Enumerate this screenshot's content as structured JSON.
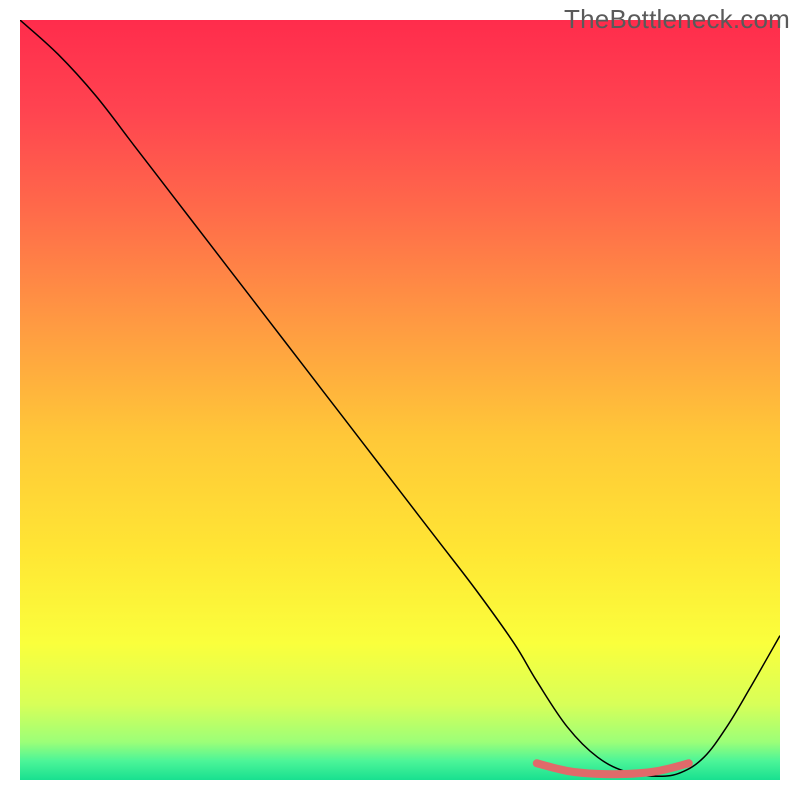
{
  "watermark": "TheBottleneck.com",
  "chart_data": {
    "type": "line",
    "title": "",
    "xlabel": "",
    "ylabel": "",
    "xlim": [
      0,
      100
    ],
    "ylim": [
      0,
      100
    ],
    "grid": false,
    "legend": false,
    "background_gradient": {
      "stops": [
        {
          "offset": 0.0,
          "color": "#ff2c4c"
        },
        {
          "offset": 0.12,
          "color": "#ff4450"
        },
        {
          "offset": 0.25,
          "color": "#ff6a4a"
        },
        {
          "offset": 0.4,
          "color": "#ff9a42"
        },
        {
          "offset": 0.55,
          "color": "#ffc838"
        },
        {
          "offset": 0.7,
          "color": "#ffe634"
        },
        {
          "offset": 0.82,
          "color": "#faff3c"
        },
        {
          "offset": 0.9,
          "color": "#d8ff58"
        },
        {
          "offset": 0.95,
          "color": "#9cff78"
        },
        {
          "offset": 0.975,
          "color": "#4cf598"
        },
        {
          "offset": 1.0,
          "color": "#18e090"
        }
      ]
    },
    "series": [
      {
        "name": "bottleneck-curve",
        "color": "#000000",
        "width": 1.5,
        "x": [
          0,
          5,
          10,
          15,
          20,
          25,
          30,
          35,
          40,
          45,
          50,
          55,
          60,
          65,
          68,
          72,
          76,
          80,
          84,
          87,
          90,
          93,
          96,
          100
        ],
        "y": [
          100,
          95.5,
          90,
          83.5,
          77,
          70.5,
          64,
          57.5,
          51,
          44.5,
          38,
          31.5,
          25,
          18,
          13,
          7,
          3,
          1,
          0.5,
          1,
          3,
          7,
          12,
          19
        ]
      },
      {
        "name": "optimal-zone-marker",
        "color": "#e06a6a",
        "width": 8,
        "linecap": "round",
        "x": [
          68,
          72,
          76,
          80,
          84,
          88
        ],
        "y": [
          2.2,
          1.2,
          0.8,
          0.8,
          1.2,
          2.2
        ]
      }
    ]
  }
}
